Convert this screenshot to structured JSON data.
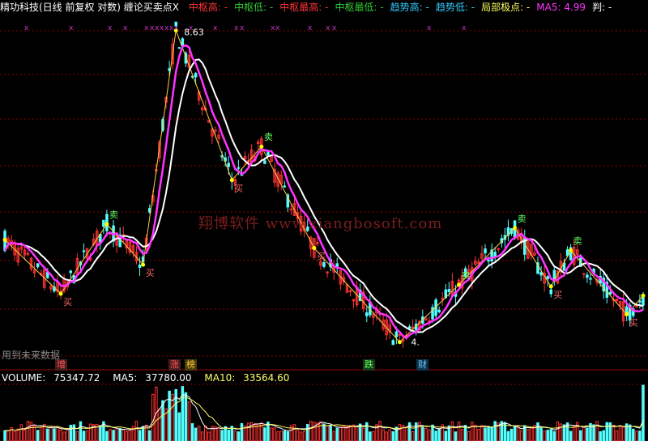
{
  "header": {
    "title": "精功科技(日线 前复权 对数) 缠论买卖点X",
    "items": [
      {
        "label": "中枢高:",
        "value": "-",
        "color": "#ff3333"
      },
      {
        "label": "中枢低:",
        "value": "-",
        "color": "#33cc33"
      },
      {
        "label": "中枢最高:",
        "value": "-",
        "color": "#ff3333"
      },
      {
        "label": "中枢最低:",
        "value": "-",
        "color": "#33cc33"
      },
      {
        "label": "趋势高:",
        "value": "-",
        "color": "#33ccff"
      },
      {
        "label": "趋势低:",
        "value": "-",
        "color": "#33ccff"
      },
      {
        "label": "局部极点:",
        "value": "-",
        "color": "#ffff66"
      },
      {
        "label": "MA5:",
        "value": "4.99",
        "color": "#ff33ff"
      },
      {
        "label": "判:",
        "value": "-",
        "color": "#ffffff"
      }
    ]
  },
  "volume_header": {
    "volume": {
      "label": "VOLUME:",
      "value": "75347.72",
      "color": "#ffffff"
    },
    "ma5": {
      "label": "MA5:",
      "value": "37780.00",
      "color": "#ffffff"
    },
    "ma10": {
      "label": "MA10:",
      "value": "33564.60",
      "color": "#ffff66"
    }
  },
  "note": "用到未来数据",
  "watermark": "翔博软件 www.xiangbosoft.com",
  "high_label": "8.63",
  "low_label": "4.",
  "bottom_tags": [
    {
      "text": "增",
      "bg": "#4a1c1c",
      "color": "#ff5555"
    },
    {
      "text": "涨",
      "bg": "#4a1c1c",
      "color": "#ff5555"
    },
    {
      "text": "榜",
      "bg": "#4a3a10",
      "color": "#ffcc33"
    },
    {
      "text": "跌",
      "bg": "#163a16",
      "color": "#66ff66"
    },
    {
      "text": "财",
      "bg": "#10304a",
      "color": "#66ccff"
    }
  ],
  "signal_text": {
    "buy": "买",
    "sell": "卖"
  },
  "colors": {
    "up": "#ff3333",
    "down": "#54ffff",
    "ma_white": "#ffffff",
    "ma_magenta": "#ff33ff",
    "zigzag": "#ffcc44",
    "grid": "#8b0000",
    "point": "#ffff00",
    "marker": "#cc33cc"
  },
  "chart_data": {
    "type": "candlestick",
    "x_count": 195,
    "price_range": [
      4.0,
      8.63
    ],
    "zigzag_turns": [
      {
        "bar": 0,
        "price": 5.25
      },
      {
        "bar": 17,
        "price": 4.62
      },
      {
        "bar": 31,
        "price": 5.45
      },
      {
        "bar": 42,
        "price": 4.95
      },
      {
        "bar": 52,
        "price": 8.63
      },
      {
        "bar": 69,
        "price": 6.05
      },
      {
        "bar": 78,
        "price": 6.55
      },
      {
        "bar": 94,
        "price": 5.15
      },
      {
        "bar": 120,
        "price": 4.12
      },
      {
        "bar": 138,
        "price": 4.72
      },
      {
        "bar": 155,
        "price": 5.4
      },
      {
        "bar": 166,
        "price": 4.7
      },
      {
        "bar": 172,
        "price": 5.12
      },
      {
        "bar": 189,
        "price": 4.4
      },
      {
        "bar": 194,
        "price": 4.6
      }
    ],
    "signals": [
      {
        "bar": 17,
        "type": "buy"
      },
      {
        "bar": 31,
        "type": "sell"
      },
      {
        "bar": 42,
        "type": "buy"
      },
      {
        "bar": 69,
        "type": "buy"
      },
      {
        "bar": 78,
        "type": "sell"
      },
      {
        "bar": 94,
        "type": "buy"
      },
      {
        "bar": 138,
        "type": "sell"
      },
      {
        "bar": 155,
        "type": "sell"
      },
      {
        "bar": 166,
        "type": "buy"
      },
      {
        "bar": 172,
        "type": "sell"
      },
      {
        "bar": 189,
        "type": "buy"
      }
    ],
    "volume_range": [
      0,
      75347.72
    ],
    "volume_last": 75347.72,
    "volume_ma5_last": 37780.0,
    "volume_ma10_last": 33564.6
  }
}
